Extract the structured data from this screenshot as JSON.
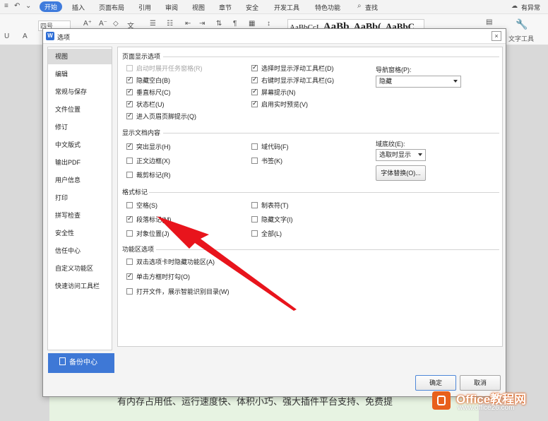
{
  "ribbon": {
    "menu": [
      "开始",
      "插入",
      "页面布局",
      "引用",
      "审阅",
      "视图",
      "章节",
      "安全",
      "开发工具",
      "特色功能"
    ],
    "search": "查找",
    "right_status": "有异常",
    "font_name": "四号",
    "styles": [
      "AaBbCcI",
      "AaBb",
      "AaBb(",
      "AaBbC"
    ],
    "text_tool": "文字工具"
  },
  "document": {
    "visible_line": "有内存占用低、运行速度快、体积小巧、强大插件平台支持、免费提"
  },
  "dialog": {
    "title": "选项",
    "close": "×",
    "nav": [
      "视图",
      "编辑",
      "常规与保存",
      "文件位置",
      "修订",
      "中文版式",
      "输出PDF",
      "用户信息",
      "打印",
      "拼写检查",
      "安全性",
      "信任中心",
      "自定义功能区",
      "快速访问工具栏"
    ],
    "active_nav": "视图",
    "backup_label": "备份中心",
    "sections": {
      "page_display": {
        "title": "页面显示选项",
        "checkboxes": [
          {
            "label": "启动时展开任务窗格(R)",
            "checked": false,
            "disabled": true
          },
          {
            "label": "隐藏空白(B)",
            "checked": true
          },
          {
            "label": "垂直标尺(C)",
            "checked": true
          },
          {
            "label": "状态栏(U)",
            "checked": true
          },
          {
            "label": "进入页眉页脚提示(Q)",
            "checked": true
          },
          {
            "label": "选择时显示浮动工具栏(D)",
            "checked": true
          },
          {
            "label": "右键时显示浮动工具栏(G)",
            "checked": true
          },
          {
            "label": "屏幕提示(N)",
            "checked": true
          },
          {
            "label": "启用实时预览(V)",
            "checked": true
          }
        ],
        "nav_pane_label": "导航窗格(P):",
        "nav_pane_value": "隐藏"
      },
      "doc_content": {
        "title": "显示文档内容",
        "checkboxes": [
          {
            "label": "突出显示(H)",
            "checked": true
          },
          {
            "label": "正文边框(X)",
            "checked": false
          },
          {
            "label": "裁剪标记(R)",
            "checked": false
          },
          {
            "label": "域代码(F)",
            "checked": false
          },
          {
            "label": "书签(K)",
            "checked": false
          }
        ],
        "field_shading_label": "域底纹(E):",
        "field_shading_value": "选取时显示",
        "font_sub_button": "字体替换(O)..."
      },
      "format_marks": {
        "title": "格式标记",
        "checkboxes": [
          {
            "label": "空格(S)",
            "checked": false
          },
          {
            "label": "段落标记(M)",
            "checked": true
          },
          {
            "label": "对象位置(J)",
            "checked": false
          },
          {
            "label": "制表符(T)",
            "checked": false
          },
          {
            "label": "隐藏文字(I)",
            "checked": false
          },
          {
            "label": "全部(L)",
            "checked": false
          }
        ]
      },
      "ribbon_opts": {
        "title": "功能区选项",
        "checkboxes": [
          {
            "label": "双击选项卡时隐藏功能区(A)",
            "checked": false
          },
          {
            "label": "单击方框时打勾(O)",
            "checked": true
          },
          {
            "label": "打开文件，展示智能识别目录(W)",
            "checked": false
          }
        ]
      }
    },
    "ok_label": "确定",
    "cancel_label": "取消"
  },
  "watermark": {
    "title": "Office教程网",
    "url": "www.office26.com"
  },
  "colors": {
    "accent": "#3e78d6",
    "arrow": "#e8141c",
    "watermark": "#e8601c"
  }
}
